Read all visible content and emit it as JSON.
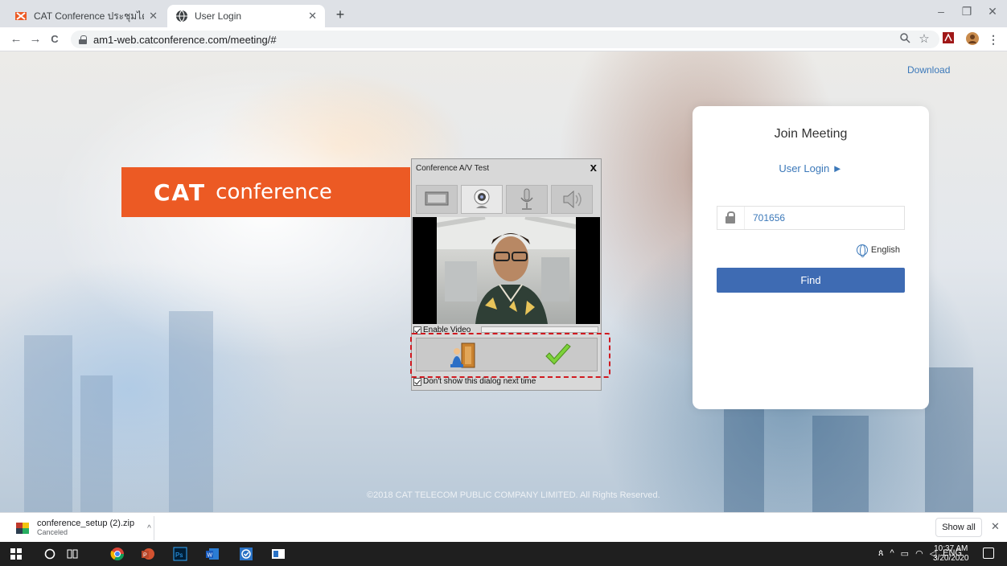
{
  "browser": {
    "tabs": [
      {
        "title": "CAT Conference ประชุมได้ใช้ชีดจำกั",
        "close": "✕"
      },
      {
        "title": "User Login",
        "close": "✕"
      }
    ],
    "new_tab": "+",
    "window_controls": {
      "minimize": "–",
      "maximize": "❐",
      "close": "✕"
    },
    "nav": {
      "back": "←",
      "forward": "→",
      "reload": "C"
    },
    "url": "am1-web.catconference.com/meeting/#",
    "toolbar_icons": [
      "zoom-icon",
      "bookmark-star-icon",
      "pdf-extension-icon",
      "profile-avatar-icon",
      "menu-icon"
    ]
  },
  "page": {
    "download_link": "Download",
    "logo": {
      "bold": "CAT",
      "light": "conference"
    },
    "join": {
      "title": "Join Meeting",
      "user_login": "User Login ►",
      "meeting_id": "701656",
      "language": "English",
      "find_label": "Find"
    },
    "footer": "©2018 CAT TELECOM PUBLIC COMPANY LIMITED. All Rights Reserved."
  },
  "av_dialog": {
    "title": "Conference A/V Test",
    "close": "x",
    "tabs": [
      "monitor-icon",
      "webcam-icon",
      "microphone-icon",
      "speaker-icon"
    ],
    "selected_tab": 1,
    "enable_video_label": "Enable Video",
    "enable_video_checked": true,
    "dont_show_label": "Don't show this dialog next time",
    "dont_show_checked": true,
    "actions": [
      "exit-door-icon",
      "checkmark-icon"
    ]
  },
  "download_bar": {
    "filename": "conference_setup (2).zip",
    "status": "Canceled",
    "chevron": "^",
    "show_all": "Show all",
    "close": "✕"
  },
  "taskbar": {
    "apps": [
      "windows-start-icon",
      "search-circle-icon",
      "task-view-icon",
      "chrome-icon",
      "powerpoint-icon",
      "photoshop-icon",
      "word-icon",
      "tasks-app-icon",
      "generic-app-icon"
    ],
    "tray": {
      "input": "ENG"
    },
    "time": "10:37 AM",
    "date": "3/20/2020"
  },
  "colors": {
    "brand_orange": "#ec5a24",
    "link_blue": "#3b78b9",
    "find_button": "#3e6bb3",
    "highlight_red": "#d0191f"
  }
}
